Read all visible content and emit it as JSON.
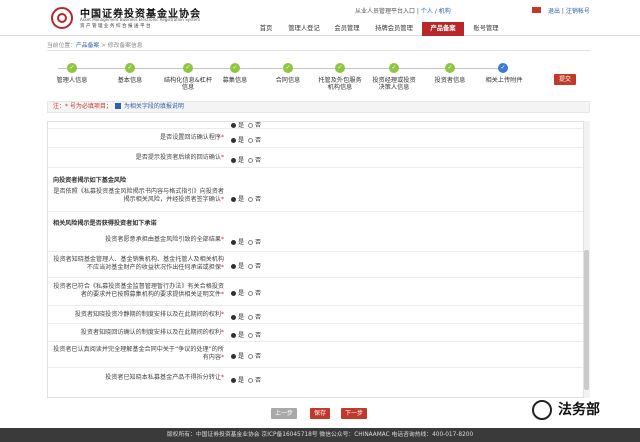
{
  "header": {
    "logo_cn": "中国证券投资基金业协会",
    "logo_en": "Asset Management Business Electronic Registration System",
    "logo_sub": "资产管理业务综合报送平台",
    "user_prefix": "从业人员管理平台入口",
    "user_link1": "个人",
    "user_link2": "机构",
    "topright": "退出 | 注销帐号"
  },
  "nav": [
    "首页",
    "管理人登记",
    "会员管理",
    "持牌会员管理",
    "产品备案",
    "账号管理"
  ],
  "breadcrumb": {
    "current_label": "当前位置：",
    "link": "产品备案",
    "sep": " > ",
    "page": "修改备案信息"
  },
  "steps": [
    {
      "label": "管理人信息"
    },
    {
      "label": "基本信息"
    },
    {
      "label": "结构化信息&杠杆信息"
    },
    {
      "label": "募集信息"
    },
    {
      "label": "合同信息"
    },
    {
      "label": "托管及外包服务机构信息"
    },
    {
      "label": "投资经理或投资决策人信息"
    },
    {
      "label": "投资者信息"
    },
    {
      "label": "相关上传附件"
    }
  ],
  "submit_label": "提交",
  "legend": {
    "required": "注：* 号为必填项目；",
    "hint": "为相关字段的填报说明"
  },
  "radio_yes": "是",
  "radio_no": "否",
  "sections": {
    "s1": "向投资者揭示如下基金风险",
    "s2": "相关风险揭示是否获得投资者如下承诺"
  },
  "rows": {
    "r1": "是否设置回访确认程序",
    "r2": "是否提示投资者后续的回访确认",
    "r3": "是否依照《私募投资基金风险揭示书内容与格式指引》向投资者揭示相关风险，并经投资者签字确认",
    "r4": "投资者愿意承担由基金风险引致的全部结果",
    "r5": "投资者知晓基金管理人、基金销售机构、基金托管人及相关机构不应当对基金财产的收益状况作出任何承诺或担保",
    "r6": "投资者已符合《私募投资基金监督管理暂行办法》有关合格投资者的要求并已按照募集机构的要求提供相关证明文件",
    "r7": "投资者知晓投资冷静期的制度安排以及在此期间的权利",
    "r8": "投资者知晓回访确认的制度安排以及在此期间的权利",
    "r9": "投资者已认真阅读并完全理解基金合同中关于“争议的处理”的所有内容",
    "r10": "投资者已知晓本私募基金产品不得拆分转让"
  },
  "buttons": {
    "prev": "上一步",
    "save": "保存",
    "next": "下一步"
  },
  "footer": "版权所有：中国证券投资基金业协会    京ICP备16045718号    微信公众号：CHINAAMAC    电话咨询热线：400-017-8200",
  "watermark": "法务部",
  "colors": {
    "brand": "#b8282b",
    "done": "#8ec641",
    "current": "#3a7bd5",
    "link": "#2a63a8"
  }
}
